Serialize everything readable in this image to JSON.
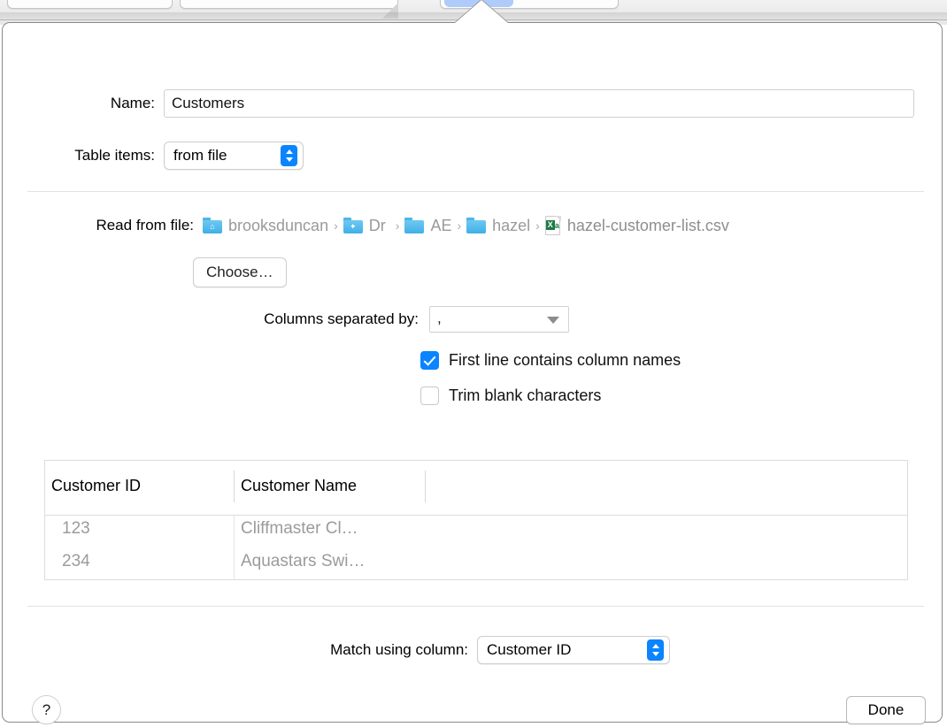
{
  "background": {
    "toolbar_selected_item": ""
  },
  "dialog": {
    "name_field": {
      "label": "Name:",
      "value": "Customers",
      "placeholder": ""
    },
    "table_items": {
      "label": "Table items:",
      "selected": "from file"
    },
    "read_from_file": {
      "label": "Read from file:",
      "breadcrumb": [
        {
          "icon": "folder-home-icon",
          "label": "brooksduncan",
          "truncated": false
        },
        {
          "icon": "folder-dropbox-icon",
          "label": "Dr",
          "truncated": true
        },
        {
          "icon": "folder-icon",
          "label": "AE",
          "truncated": true
        },
        {
          "icon": "folder-icon",
          "label": "hazel",
          "truncated": false
        },
        {
          "icon": "csv-file-icon",
          "label": "hazel-customer-list.csv",
          "truncated": false
        }
      ],
      "separator_glyph": "›"
    },
    "choose_button": "Choose…",
    "columns_separated_by": {
      "label": "Columns separated by:",
      "value": ","
    },
    "first_line_checkbox": {
      "label": "First line contains column names",
      "checked": true
    },
    "trim_blank_checkbox": {
      "label": "Trim blank characters",
      "checked": false
    },
    "preview_table": {
      "columns": [
        "Customer ID",
        "Customer Name"
      ],
      "rows": [
        [
          "123",
          "Cliffmaster Cl…"
        ],
        [
          "234",
          "Aquastars Swi…"
        ]
      ]
    },
    "match_using_column": {
      "label": "Match using column:",
      "selected": "Customer ID"
    },
    "help_button": "?",
    "done_button": "Done"
  },
  "colors": {
    "accent": "#0a84ff",
    "folder": "#3fb0e8",
    "csv_green": "#1d7b43",
    "selection_pill": "#aecbfa",
    "muted_text": "#9b9b9b"
  }
}
